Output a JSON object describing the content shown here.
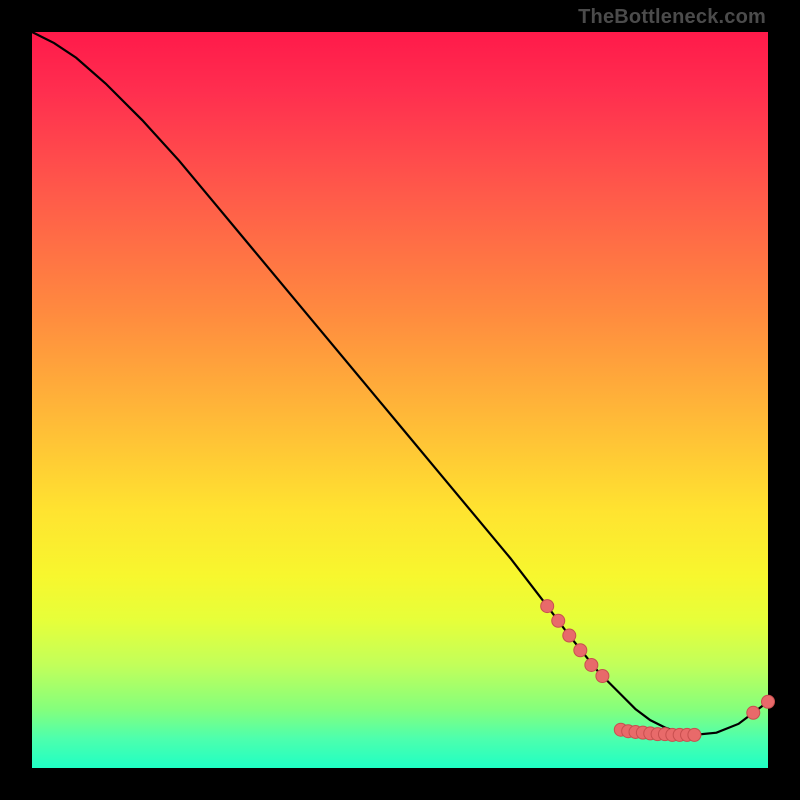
{
  "watermark": "TheBottleneck.com",
  "colors": {
    "curve": "#000000",
    "marker_fill": "#e86a6a",
    "marker_stroke": "#c84f4f"
  },
  "chart_data": {
    "type": "line",
    "title": "",
    "xlabel": "",
    "ylabel": "",
    "xlim": [
      0,
      100
    ],
    "ylim": [
      0,
      100
    ],
    "x": [
      0,
      3,
      6,
      10,
      15,
      20,
      25,
      30,
      35,
      40,
      45,
      50,
      55,
      60,
      65,
      70,
      73,
      75,
      77,
      80,
      82,
      84,
      86,
      88,
      90,
      93,
      96,
      98,
      100
    ],
    "y": [
      100,
      98.5,
      96.5,
      93,
      88,
      82.5,
      76.5,
      70.5,
      64.5,
      58.5,
      52.5,
      46.5,
      40.5,
      34.5,
      28.5,
      22,
      18,
      15.5,
      13,
      10,
      8,
      6.5,
      5.5,
      4.8,
      4.5,
      4.8,
      6,
      7.5,
      9
    ],
    "markers": [
      {
        "x": 70,
        "y": 22
      },
      {
        "x": 71.5,
        "y": 20
      },
      {
        "x": 73,
        "y": 18
      },
      {
        "x": 74.5,
        "y": 16
      },
      {
        "x": 76,
        "y": 14
      },
      {
        "x": 77.5,
        "y": 12.5
      },
      {
        "x": 80,
        "y": 5.2
      },
      {
        "x": 81,
        "y": 5.0
      },
      {
        "x": 82,
        "y": 4.9
      },
      {
        "x": 83,
        "y": 4.8
      },
      {
        "x": 84,
        "y": 4.7
      },
      {
        "x": 85,
        "y": 4.6
      },
      {
        "x": 86,
        "y": 4.6
      },
      {
        "x": 87,
        "y": 4.5
      },
      {
        "x": 88,
        "y": 4.5
      },
      {
        "x": 89,
        "y": 4.5
      },
      {
        "x": 90,
        "y": 4.5
      },
      {
        "x": 98,
        "y": 7.5
      },
      {
        "x": 100,
        "y": 9
      }
    ]
  }
}
